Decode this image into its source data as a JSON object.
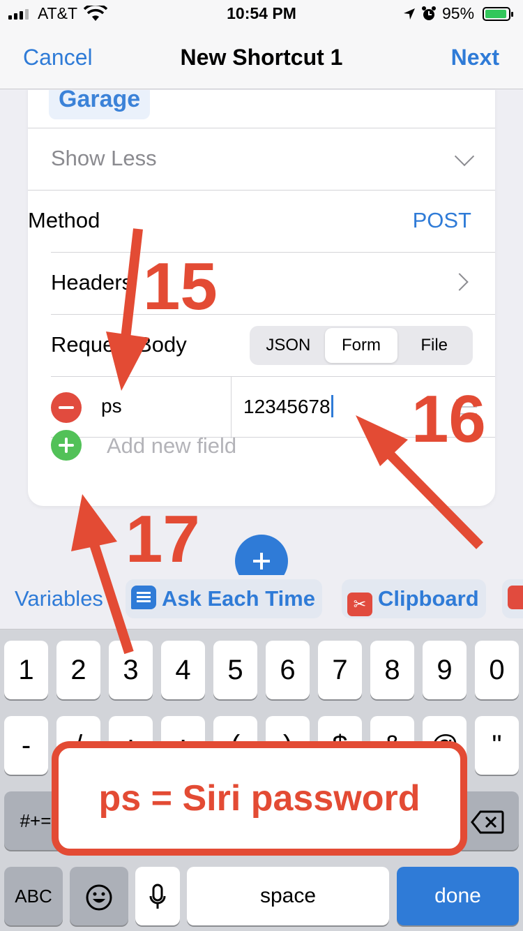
{
  "status_bar": {
    "carrier": "AT&T",
    "time": "10:54 PM",
    "battery": "95%",
    "battery_level": 0.95
  },
  "nav": {
    "cancel": "Cancel",
    "title": "New Shortcut 1",
    "next": "Next"
  },
  "card": {
    "chip": "Garage",
    "show_less": "Show Less",
    "method_label": "Method",
    "method_value": "POST",
    "headers_label": "Headers",
    "request_body_label": "Request Body",
    "segments": [
      "JSON",
      "Form",
      "File"
    ],
    "selected_segment": "Form",
    "field": {
      "key": "ps",
      "value": "12345678"
    },
    "add_field": "Add new field"
  },
  "suggestions": {
    "variables": "Variables",
    "ask": "Ask Each Time",
    "clipboard": "Clipboard"
  },
  "keyboard": {
    "row1": [
      "1",
      "2",
      "3",
      "4",
      "5",
      "6",
      "7",
      "8",
      "9",
      "0"
    ],
    "row2": [
      "-",
      "/",
      ":",
      ";",
      "(",
      ")",
      "$",
      "&",
      "@",
      "\""
    ],
    "sym_key": "#+=",
    "abc_key": "ABC",
    "space_key": "space",
    "done_key": "done"
  },
  "annotations": {
    "step15": "15",
    "step16": "16",
    "step17": "17",
    "callout": "ps = Siri password"
  },
  "colors": {
    "accent": "#2f7bd7",
    "annotation": "#e34b34",
    "delete": "#e14b3e",
    "add": "#52c158"
  }
}
